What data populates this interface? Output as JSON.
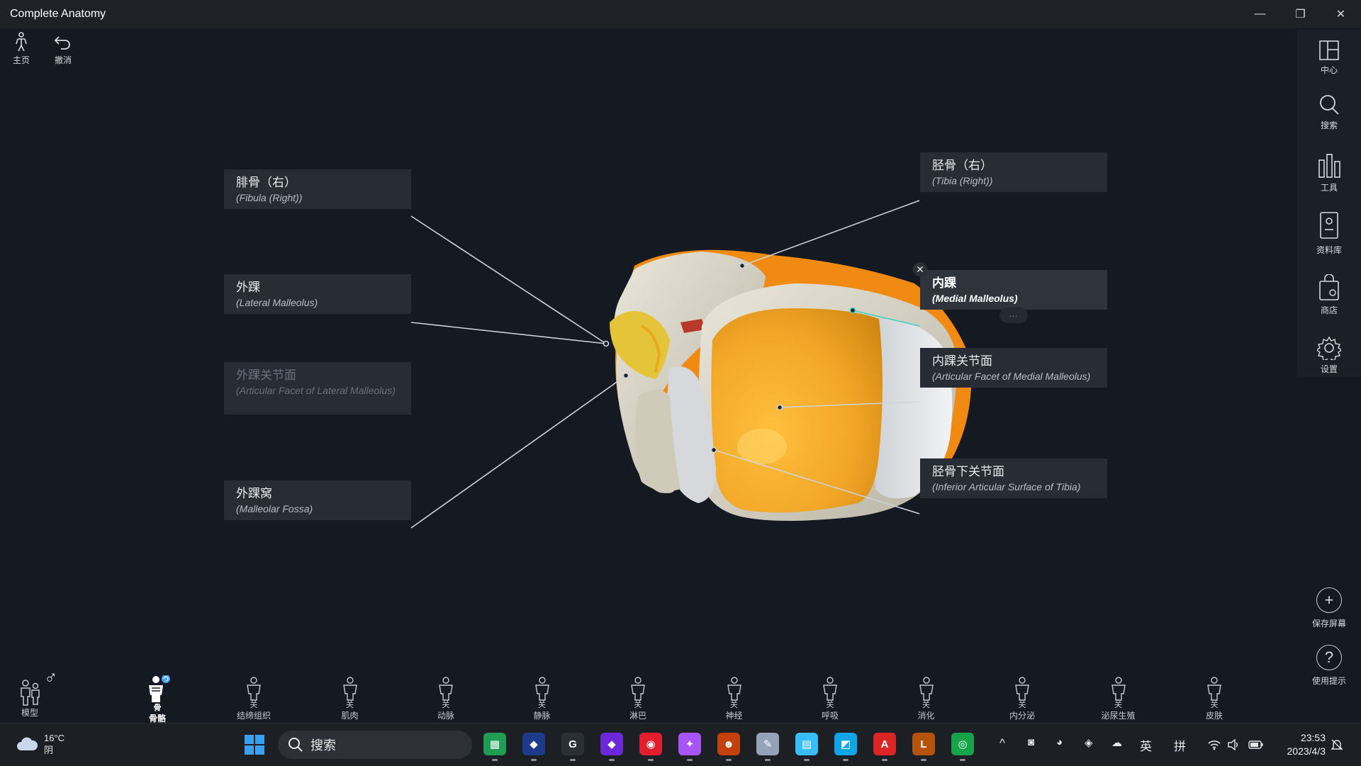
{
  "window": {
    "title": "Complete Anatomy",
    "minimize": "—",
    "restore": "❐",
    "close": "✕"
  },
  "toolbar": {
    "home": "主页",
    "undo": "撤消"
  },
  "right_sidebar": {
    "items": [
      {
        "label": "中心",
        "icon": "center-panel-icon"
      },
      {
        "label": "搜索",
        "icon": "search-icon"
      },
      {
        "label": "工具",
        "icon": "tools-icon"
      },
      {
        "label": "资料库",
        "icon": "library-icon"
      },
      {
        "label": "商店",
        "icon": "store-icon"
      },
      {
        "label": "设置",
        "icon": "gear-icon"
      }
    ],
    "save_screen": "保存屏幕",
    "help": "使用提示"
  },
  "labels": {
    "fibula": {
      "zh": "腓骨（右）",
      "en": "(Fibula (Right))"
    },
    "lateral_malleolus": {
      "zh": "外踝",
      "en": "(Lateral Malleolus)"
    },
    "facet_lateral": {
      "zh": "外踝关节面",
      "en": "(Articular Facet of Lateral Malleolus)"
    },
    "malleolar_fossa": {
      "zh": "外踝窝",
      "en": "(Malleolar Fossa)"
    },
    "tibia": {
      "zh": "胫骨（右）",
      "en": "(Tibia (Right))"
    },
    "medial_malleolus": {
      "zh": "内踝",
      "en": "(Medial Malleolus)"
    },
    "facet_medial": {
      "zh": "内踝关节面",
      "en": "(Articular Facet of Medial Malleolus)"
    },
    "inferior_surface": {
      "zh": "胫骨下关节面",
      "en": "(Inferior Articular Surface of Tibia)"
    }
  },
  "label_controls": {
    "close": "✕",
    "more": "..."
  },
  "systems": [
    {
      "label": "模型",
      "active": false
    },
    {
      "label": "骨骼",
      "sub": "骨",
      "active": true
    },
    {
      "label": "结缔组织",
      "sub": "关",
      "active": false
    },
    {
      "label": "肌肉",
      "sub": "关",
      "active": false
    },
    {
      "label": "动脉",
      "sub": "关",
      "active": false
    },
    {
      "label": "静脉",
      "sub": "关",
      "active": false
    },
    {
      "label": "淋巴",
      "sub": "关",
      "active": false
    },
    {
      "label": "神经",
      "sub": "关",
      "active": false
    },
    {
      "label": "呼吸",
      "sub": "关",
      "active": false
    },
    {
      "label": "消化",
      "sub": "关",
      "active": false
    },
    {
      "label": "内分泌",
      "sub": "关",
      "active": false
    },
    {
      "label": "泌尿生殖",
      "sub": "关",
      "active": false
    },
    {
      "label": "皮肤",
      "sub": "关",
      "active": false
    }
  ],
  "gender_symbol": "♂",
  "taskbar": {
    "weather_temp": "16°C",
    "weather_desc": "阴",
    "search_placeholder": "搜索",
    "apps": [
      {
        "name": "spreadsheet-app",
        "color": "#1f9d55",
        "glyph": "▦"
      },
      {
        "name": "cat-app",
        "color": "#1e3a8a",
        "glyph": "◆"
      },
      {
        "name": "grammarly-app",
        "color": "#2b2f36",
        "glyph": "G"
      },
      {
        "name": "obsidian-app",
        "color": "#6d28d9",
        "glyph": "◆"
      },
      {
        "name": "netease-music-app",
        "color": "#e11d2e",
        "glyph": "◉"
      },
      {
        "name": "purple-app",
        "color": "#a855f7",
        "glyph": "✦"
      },
      {
        "name": "anatomy-app",
        "color": "#c2410c",
        "glyph": "☻"
      },
      {
        "name": "notes-app",
        "color": "#94a3b8",
        "glyph": "✎"
      },
      {
        "name": "monitor-app",
        "color": "#38bdf8",
        "glyph": "▤"
      },
      {
        "name": "paint-app",
        "color": "#0ea5e9",
        "glyph": "◩"
      },
      {
        "name": "pdf-app",
        "color": "#dc2626",
        "glyph": "A"
      },
      {
        "name": "game-app",
        "color": "#b45309",
        "glyph": "L"
      },
      {
        "name": "chrome-app",
        "color": "#16a34a",
        "glyph": "◎"
      }
    ],
    "tray": {
      "chevron": "^",
      "lang1": "英",
      "lang2": "拼"
    },
    "time": "23:53",
    "date": "2023/4/3"
  }
}
